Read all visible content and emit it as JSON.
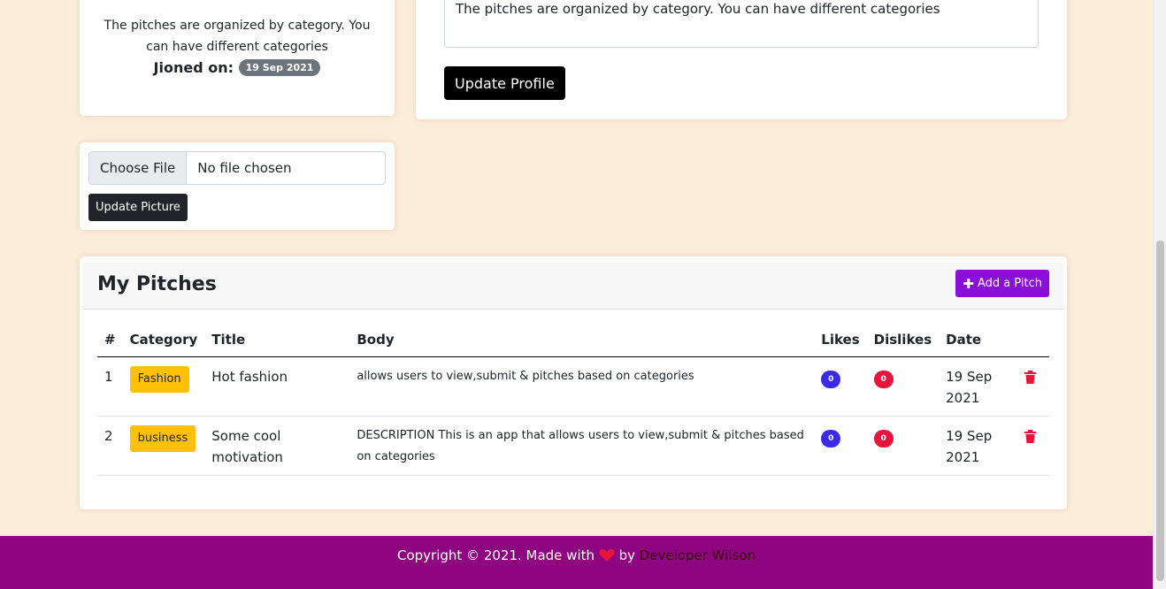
{
  "profile": {
    "bio": "The pitches are organized by category. You can have different categories",
    "joined_label": "Jioned on:",
    "joined_date": "19 Sep 2021"
  },
  "edit_profile": {
    "bio_value": "The pitches are organized by category. You can have different categories",
    "update_button": "Update Profile"
  },
  "picture": {
    "choose_file": "Choose File",
    "file_status": "No file chosen",
    "update_button": "Update Picture"
  },
  "pitches": {
    "title": "My Pitches",
    "add_button": "Add a Pitch",
    "columns": [
      "#",
      "Category",
      "Title",
      "Body",
      "Likes",
      "Dislikes",
      "Date"
    ],
    "rows": [
      {
        "num": "1",
        "category": "Fashion",
        "title": "Hot fashion",
        "body": "allows users to view,submit & pitches based on categories",
        "likes": "0",
        "dislikes": "0",
        "date": "19 Sep 2021"
      },
      {
        "num": "2",
        "category": "business",
        "title": "Some cool motivation",
        "body": "DESCRIPTION This is an app that allows users to view,submit & pitches based on categories",
        "likes": "0",
        "dislikes": "0",
        "date": "19 Sep 2021"
      }
    ]
  },
  "footer": {
    "prefix": "Copyright © 2021. Made with",
    "by": "by",
    "author": "Developer Wilson"
  },
  "icons": {
    "add": "plus-icon",
    "delete": "trash-icon",
    "love": "heart-icon"
  },
  "colors": {
    "background": "#fbeed9",
    "footer": "#8d0680",
    "add_button": "#8a0fd9",
    "category_badge": "#ffc107",
    "likes_badge": "#3b2be8",
    "dislikes_badge": "#e8143c",
    "delete_icon": "#e8143c"
  }
}
